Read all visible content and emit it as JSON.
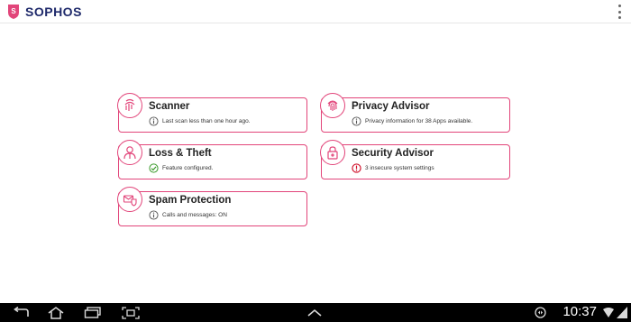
{
  "app": {
    "brand": "SOPHOS",
    "brand_color": "#1f2a6b",
    "accent_color": "#e2457a"
  },
  "cards": [
    {
      "id": "scanner",
      "title": "Scanner",
      "status_icon": "info-icon",
      "status": "Last scan less than one hour ago.",
      "badge_icon": "scanner-icon"
    },
    {
      "id": "privacy-advisor",
      "title": "Privacy Advisor",
      "status_icon": "info-icon",
      "status": "Privacy information for 38 Apps available.",
      "badge_icon": "fingerprint-icon"
    },
    {
      "id": "loss-theft",
      "title": "Loss & Theft",
      "status_icon": "check-icon",
      "status": "Feature configured.",
      "badge_icon": "person-icon"
    },
    {
      "id": "security-advisor",
      "title": "Security Advisor",
      "status_icon": "warning-icon",
      "status": "3 insecure system settings",
      "badge_icon": "lock-icon"
    },
    {
      "id": "spam-protection",
      "title": "Spam Protection",
      "status_icon": "info-icon",
      "status": "Calls and messages: ON",
      "badge_icon": "mail-shield-icon"
    }
  ],
  "system_bar": {
    "time": "10:37"
  }
}
